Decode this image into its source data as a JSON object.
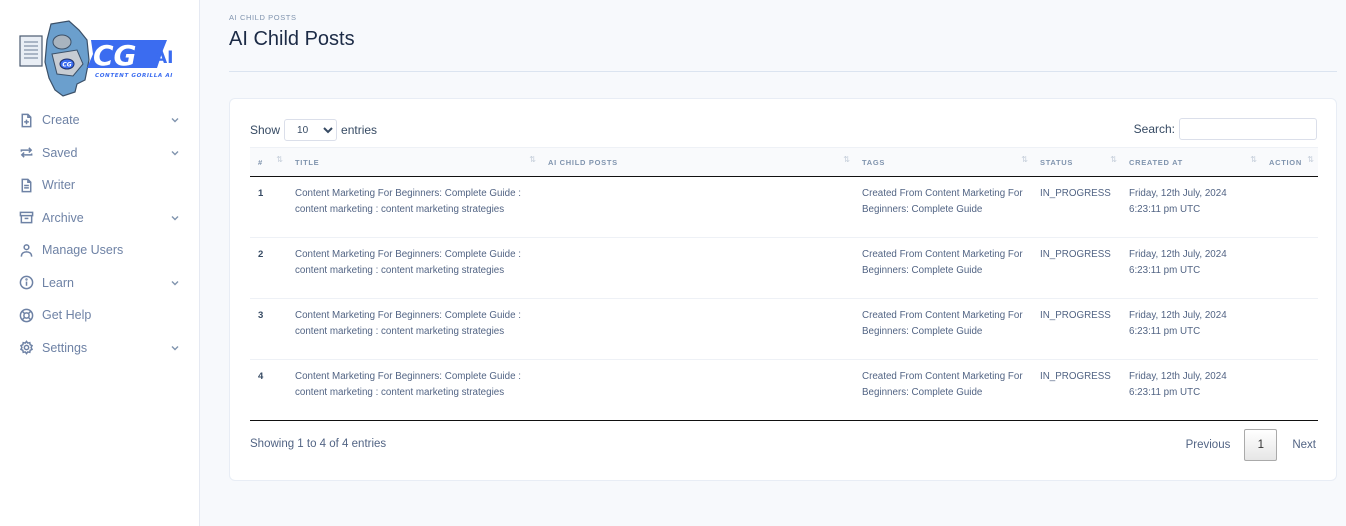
{
  "brand": {
    "logo_text": "CG",
    "logo_suffix": "AI",
    "logo_tagline": "CONTENT GORILLA AI",
    "colors": {
      "primary": "#3b6cf0",
      "mascot": "#6a9fc9"
    }
  },
  "sidebar": {
    "items": [
      {
        "label": "Create",
        "icon": "file-plus-icon",
        "has_submenu": true
      },
      {
        "label": "Saved",
        "icon": "repeat-icon",
        "has_submenu": true
      },
      {
        "label": "Writer",
        "icon": "file-text-icon",
        "has_submenu": false
      },
      {
        "label": "Archive",
        "icon": "archive-icon",
        "has_submenu": true
      },
      {
        "label": "Manage Users",
        "icon": "user-icon",
        "has_submenu": false
      },
      {
        "label": "Learn",
        "icon": "info-icon",
        "has_submenu": true
      },
      {
        "label": "Get Help",
        "icon": "life-buoy-icon",
        "has_submenu": false
      },
      {
        "label": "Settings",
        "icon": "gear-icon",
        "has_submenu": true
      }
    ]
  },
  "header": {
    "breadcrumb": "AI CHILD POSTS",
    "title": "AI Child Posts"
  },
  "table_controls": {
    "show_label": "Show",
    "entries_label": "entries",
    "page_length": "10",
    "search_label": "Search:",
    "search_value": ""
  },
  "table": {
    "columns": [
      "#",
      "TITLE",
      "AI CHILD POSTS",
      "TAGS",
      "STATUS",
      "CREATED AT",
      "ACTION"
    ],
    "rows": [
      {
        "num": "1",
        "title": "Content Marketing For Beginners: Complete Guide : content marketing : content marketing strategies",
        "ai_child_posts": "",
        "tags": "Created From Content Marketing For Beginners: Complete Guide",
        "status": "IN_PROGRESS",
        "created_date": "Friday, 12th July, 2024",
        "created_time": "6:23:11 pm UTC",
        "action": ""
      },
      {
        "num": "2",
        "title": "Content Marketing For Beginners: Complete Guide : content marketing : content marketing strategies",
        "ai_child_posts": "",
        "tags": "Created From Content Marketing For Beginners: Complete Guide",
        "status": "IN_PROGRESS",
        "created_date": "Friday, 12th July, 2024",
        "created_time": "6:23:11 pm UTC",
        "action": ""
      },
      {
        "num": "3",
        "title": "Content Marketing For Beginners: Complete Guide : content marketing : content marketing strategies",
        "ai_child_posts": "",
        "tags": "Created From Content Marketing For Beginners: Complete Guide",
        "status": "IN_PROGRESS",
        "created_date": "Friday, 12th July, 2024",
        "created_time": "6:23:11 pm UTC",
        "action": ""
      },
      {
        "num": "4",
        "title": "Content Marketing For Beginners: Complete Guide : content marketing : content marketing strategies",
        "ai_child_posts": "",
        "tags": "Created From Content Marketing For Beginners: Complete Guide",
        "status": "IN_PROGRESS",
        "created_date": "Friday, 12th July, 2024",
        "created_time": "6:23:11 pm UTC",
        "action": ""
      }
    ]
  },
  "footer": {
    "info": "Showing 1 to 4 of 4 entries",
    "previous_label": "Previous",
    "current_page": "1",
    "next_label": "Next"
  }
}
